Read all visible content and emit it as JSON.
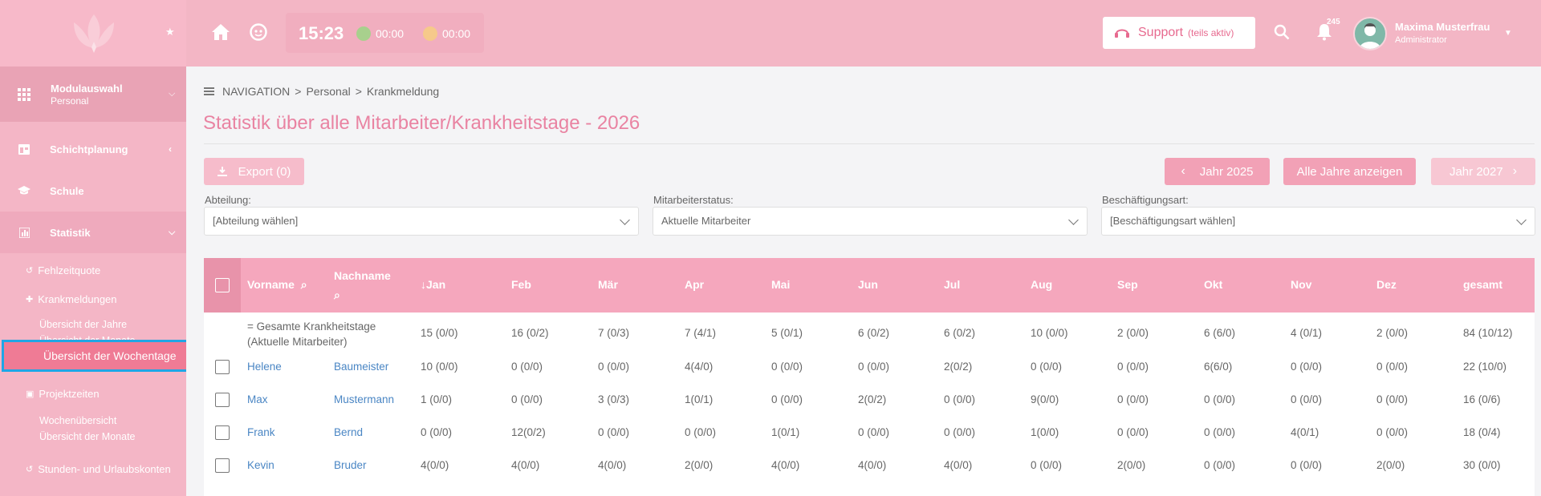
{
  "sidebar": {
    "module": {
      "title": "Modulauswahl",
      "subtitle": "Personal"
    },
    "items": [
      {
        "label": "Schichtplanung"
      },
      {
        "label": "Schule"
      },
      {
        "label": "Statistik"
      }
    ],
    "sub_items": {
      "fehlzeitquote": "Fehlzeitquote",
      "krankmeldungen": "Krankmeldungen",
      "k_jahre": "Übersicht der Jahre",
      "k_monate": "Übersicht der Monate",
      "k_wochentage": "Übersicht der Wochentage",
      "projektzeiten": "Projektzeiten",
      "p_woche": "Wochenübersicht",
      "p_monate": "Übersicht der Monate",
      "stunden": "Stunden- und Urlaubskonten"
    }
  },
  "header": {
    "time": "15:23",
    "timer1": "00:00",
    "timer2": "00:00",
    "support_label": "Support",
    "support_note": "(teils aktiv)",
    "notification_count": "245",
    "user_name": "Maxima Musterfrau",
    "user_role": "Administrator",
    "colors": {
      "header": "#f3b6c5",
      "accent": "#e983a2",
      "timer1": "#a8d08d",
      "timer2": "#f6c98a"
    }
  },
  "breadcrumb": [
    "NAVIGATION",
    "Personal",
    "Krankmeldung"
  ],
  "page_title": "Statistik über alle Mitarbeiter/Krankheitstage - 2026",
  "toolbar": {
    "export_label": "Export (0)",
    "prev_year": "Jahr 2025",
    "all_years": "Alle Jahre anzeigen",
    "next_year": "Jahr 2027"
  },
  "filters": {
    "abteilung": {
      "label": "Abteilung:",
      "value": "[Abteilung wählen]"
    },
    "status": {
      "label": "Mitarbeiterstatus:",
      "value": "Aktuelle Mitarbeiter"
    },
    "art": {
      "label": "Beschäftigungsart:",
      "value": "[Beschäftigungsart wählen]"
    }
  },
  "table": {
    "headers": {
      "vorname": "Vorname",
      "nachname": "Nachname",
      "months": [
        "Jan",
        "Feb",
        "Mär",
        "Apr",
        "Mai",
        "Jun",
        "Jul",
        "Aug",
        "Sep",
        "Okt",
        "Nov",
        "Dez",
        "gesamt"
      ]
    },
    "summary": {
      "label": "= Gesamte Krankheitstage (Aktuelle Mitarbeiter)",
      "values": [
        "15 (0/0)",
        "16 (0/2)",
        "7 (0/3)",
        "7 (4/1)",
        "5 (0/1)",
        "6 (0/2)",
        "6 (0/2)",
        "10 (0/0)",
        "2 (0/0)",
        "6 (6/0)",
        "4 (0/1)",
        "2 (0/0)",
        "84 (10/12)"
      ]
    },
    "rows": [
      {
        "vorname": "Helene",
        "nachname": "Baumeister",
        "values": [
          "10 (0/0)",
          "0 (0/0)",
          "0 (0/0)",
          "4(4/0)",
          "0 (0/0)",
          "0 (0/0)",
          "2(0/2)",
          "0 (0/0)",
          "0 (0/0)",
          "6(6/0)",
          "0 (0/0)",
          "0 (0/0)",
          "22 (10/0)"
        ]
      },
      {
        "vorname": "Max",
        "nachname": "Mustermann",
        "values": [
          "1 (0/0)",
          "0 (0/0)",
          "3 (0/3)",
          "1(0/1)",
          "0 (0/0)",
          "2(0/2)",
          "0 (0/0)",
          "9(0/0)",
          "0 (0/0)",
          "0 (0/0)",
          "0 (0/0)",
          "0 (0/0)",
          "16 (0/6)"
        ]
      },
      {
        "vorname": "Frank",
        "nachname": "Bernd",
        "values": [
          "0 (0/0)",
          "12(0/2)",
          "0 (0/0)",
          "0 (0/0)",
          "1(0/1)",
          "0 (0/0)",
          "0 (0/0)",
          "1(0/0)",
          "0 (0/0)",
          "0 (0/0)",
          "4(0/1)",
          "0 (0/0)",
          "18 (0/4)"
        ]
      },
      {
        "vorname": "Kevin",
        "nachname": "Bruder",
        "values": [
          "4(0/0)",
          "4(0/0)",
          "4(0/0)",
          "2(0/0)",
          "4(0/0)",
          "4(0/0)",
          "4(0/0)",
          "0 (0/0)",
          "2(0/0)",
          "0 (0/0)",
          "0 (0/0)",
          "2(0/0)",
          "30 (0/0)"
        ]
      }
    ]
  }
}
